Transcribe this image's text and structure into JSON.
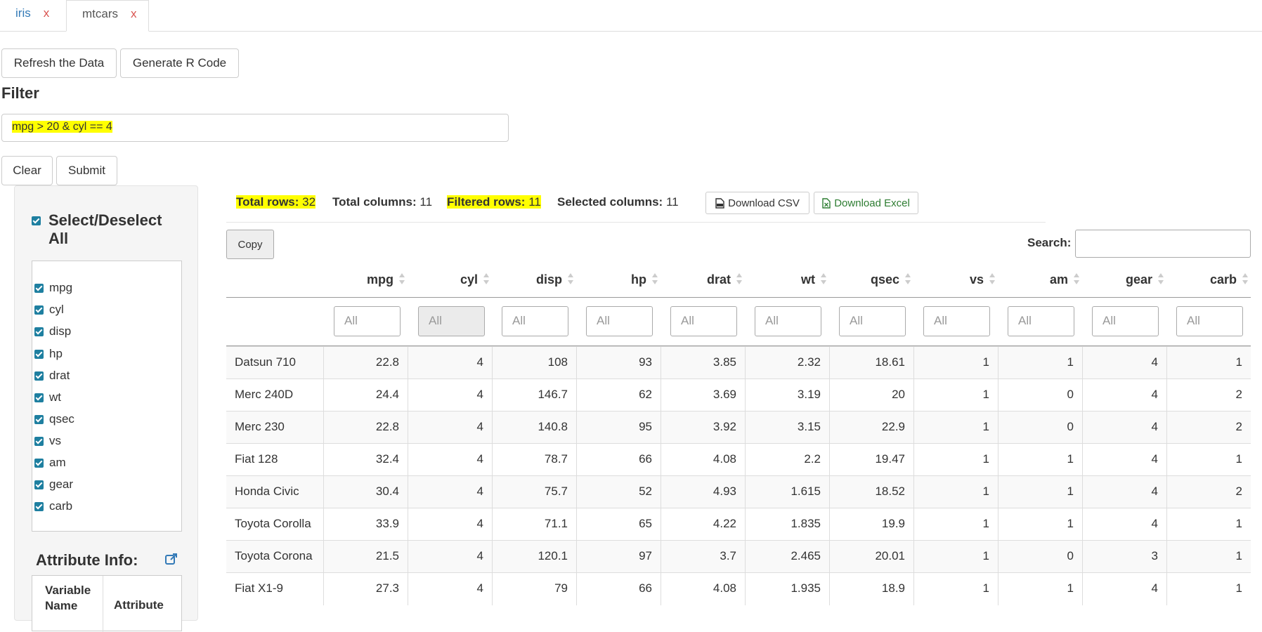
{
  "tabs": [
    {
      "label": "iris",
      "close": "x"
    },
    {
      "label": "mtcars",
      "close": "x"
    }
  ],
  "buttons": {
    "refresh": "Refresh the Data",
    "generate": "Generate R Code",
    "clear": "Clear",
    "submit": "Submit",
    "download_csv": "Download CSV",
    "download_excel": "Download Excel",
    "copy": "Copy"
  },
  "filter": {
    "heading": "Filter",
    "value": "mpg > 20 & cyl == 4"
  },
  "sidebar": {
    "select_all": "Select/Deselect All",
    "variables": [
      "mpg",
      "cyl",
      "disp",
      "hp",
      "drat",
      "wt",
      "qsec",
      "vs",
      "am",
      "gear",
      "carb"
    ],
    "attr_heading": "Attribute Info:",
    "attr_col1": "Variable Name",
    "attr_col2": "Attribute"
  },
  "stats": {
    "total_rows_label": "Total rows:",
    "total_rows": "32",
    "total_cols_label": "Total columns:",
    "total_cols": "11",
    "filtered_label": "Filtered rows:",
    "filtered": "11",
    "selected_label": "Selected columns:",
    "selected": "11"
  },
  "search": {
    "label": "Search:",
    "value": ""
  },
  "table": {
    "columns": [
      "mpg",
      "cyl",
      "disp",
      "hp",
      "drat",
      "wt",
      "qsec",
      "vs",
      "am",
      "gear",
      "carb"
    ],
    "filter_placeholder": "All",
    "rows": [
      [
        "Datsun 710",
        "22.8",
        "4",
        "108",
        "93",
        "3.85",
        "2.32",
        "18.61",
        "1",
        "1",
        "4",
        "1"
      ],
      [
        "Merc 240D",
        "24.4",
        "4",
        "146.7",
        "62",
        "3.69",
        "3.19",
        "20",
        "1",
        "0",
        "4",
        "2"
      ],
      [
        "Merc 230",
        "22.8",
        "4",
        "140.8",
        "95",
        "3.92",
        "3.15",
        "22.9",
        "1",
        "0",
        "4",
        "2"
      ],
      [
        "Fiat 128",
        "32.4",
        "4",
        "78.7",
        "66",
        "4.08",
        "2.2",
        "19.47",
        "1",
        "1",
        "4",
        "1"
      ],
      [
        "Honda Civic",
        "30.4",
        "4",
        "75.7",
        "52",
        "4.93",
        "1.615",
        "18.52",
        "1",
        "1",
        "4",
        "2"
      ],
      [
        "Toyota Corolla",
        "33.9",
        "4",
        "71.1",
        "65",
        "4.22",
        "1.835",
        "19.9",
        "1",
        "1",
        "4",
        "1"
      ],
      [
        "Toyota Corona",
        "21.5",
        "4",
        "120.1",
        "97",
        "3.7",
        "2.465",
        "20.01",
        "1",
        "0",
        "3",
        "1"
      ],
      [
        "Fiat X1-9",
        "27.3",
        "4",
        "79",
        "66",
        "4.08",
        "1.935",
        "18.9",
        "1",
        "1",
        "4",
        "1"
      ]
    ]
  },
  "colors": {
    "highlight": "#ffff00",
    "checkbox": "#1e7fa0",
    "link": "#337ab7",
    "close": "#d9534f",
    "excel": "#2e7d32"
  }
}
